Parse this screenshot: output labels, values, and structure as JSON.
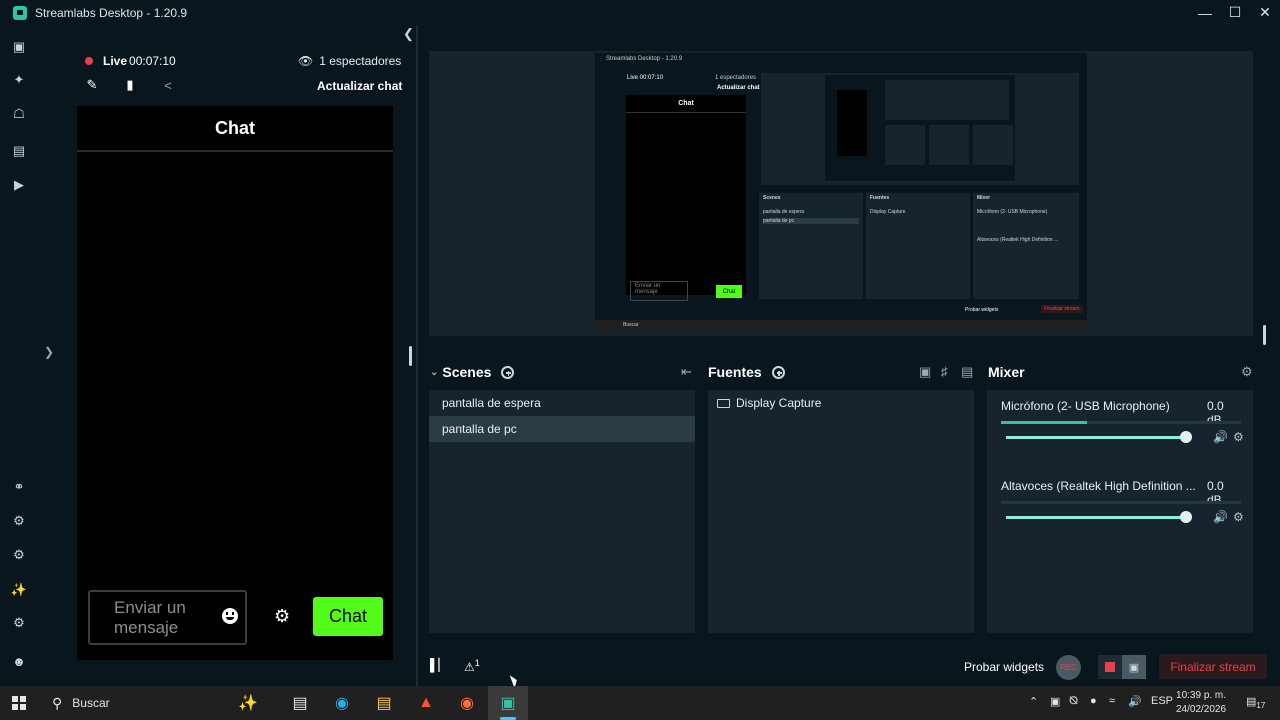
{
  "window": {
    "title": "Streamlabs Desktop - 1.20.9",
    "controls": [
      "—",
      "☐",
      "✕"
    ]
  },
  "leftnav": {
    "icons": [
      "camera-icon",
      "themes-icon",
      "store-icon",
      "layout-icon",
      "play-icon",
      "collab-icon",
      "apps-icon",
      "apps2-icon",
      "ai-icon",
      "settings-icon",
      "profile-icon"
    ]
  },
  "live": {
    "label": "Live",
    "time": "00:07:10",
    "viewers": "1 espectadores",
    "refresh": "Actualizar chat"
  },
  "chat": {
    "title": "Chat",
    "input_placeholder": "Enviar un mensaje",
    "send_label": "Chat"
  },
  "nested": {
    "title": "Streamlabs Desktop - 1.20.9",
    "live": "Live 00:07:10",
    "viewers": "1 espectadores",
    "refresh": "Actualizar chat",
    "chat": "Chat",
    "scenes": "Scenes",
    "sources": "Fuentes",
    "mixer": "Mixer",
    "scene1": "pantalla de espera",
    "scene2": "pantalla de pc",
    "source1": "Display Capture",
    "mic": "Micrófono (2- USB Microphone)",
    "spk": "Altavoces (Realtek High Definition ...",
    "db": "0.0 dB",
    "input": "Enviar un mensaje",
    "send": "Chat",
    "test": "Probar widgets",
    "end": "Finalizar stream",
    "search": "Buscar"
  },
  "scenes": {
    "title": "Scenes",
    "items": [
      {
        "label": "pantalla de espera",
        "active": false
      },
      {
        "label": "pantalla de pc",
        "active": true
      }
    ]
  },
  "sources": {
    "title": "Fuentes",
    "items": [
      {
        "label": "Display Capture"
      }
    ]
  },
  "mixer": {
    "title": "Mixer",
    "channels": [
      {
        "name": "Micrófono (2- USB Microphone)",
        "db": "0.0 dB",
        "level": 0.36,
        "volume": 1.0
      },
      {
        "name": "Altavoces (Realtek High Definition ...",
        "db": "0.0 dB",
        "level": 0.0,
        "volume": 1.0
      }
    ]
  },
  "footer": {
    "alerts": "1",
    "test_widgets": "Probar widgets",
    "rec": "REC",
    "end_stream": "Finalizar stream"
  },
  "taskbar": {
    "search": "Buscar",
    "lang": "ESP",
    "time": "10:39 p. m.",
    "date": "24/02/2026",
    "notifications": "17"
  },
  "colors": {
    "accent": "#31c3a2",
    "chat_green": "#53fc18",
    "live_red": "#eb3f4c",
    "panel": "#17242d",
    "bg": "#09161d"
  }
}
